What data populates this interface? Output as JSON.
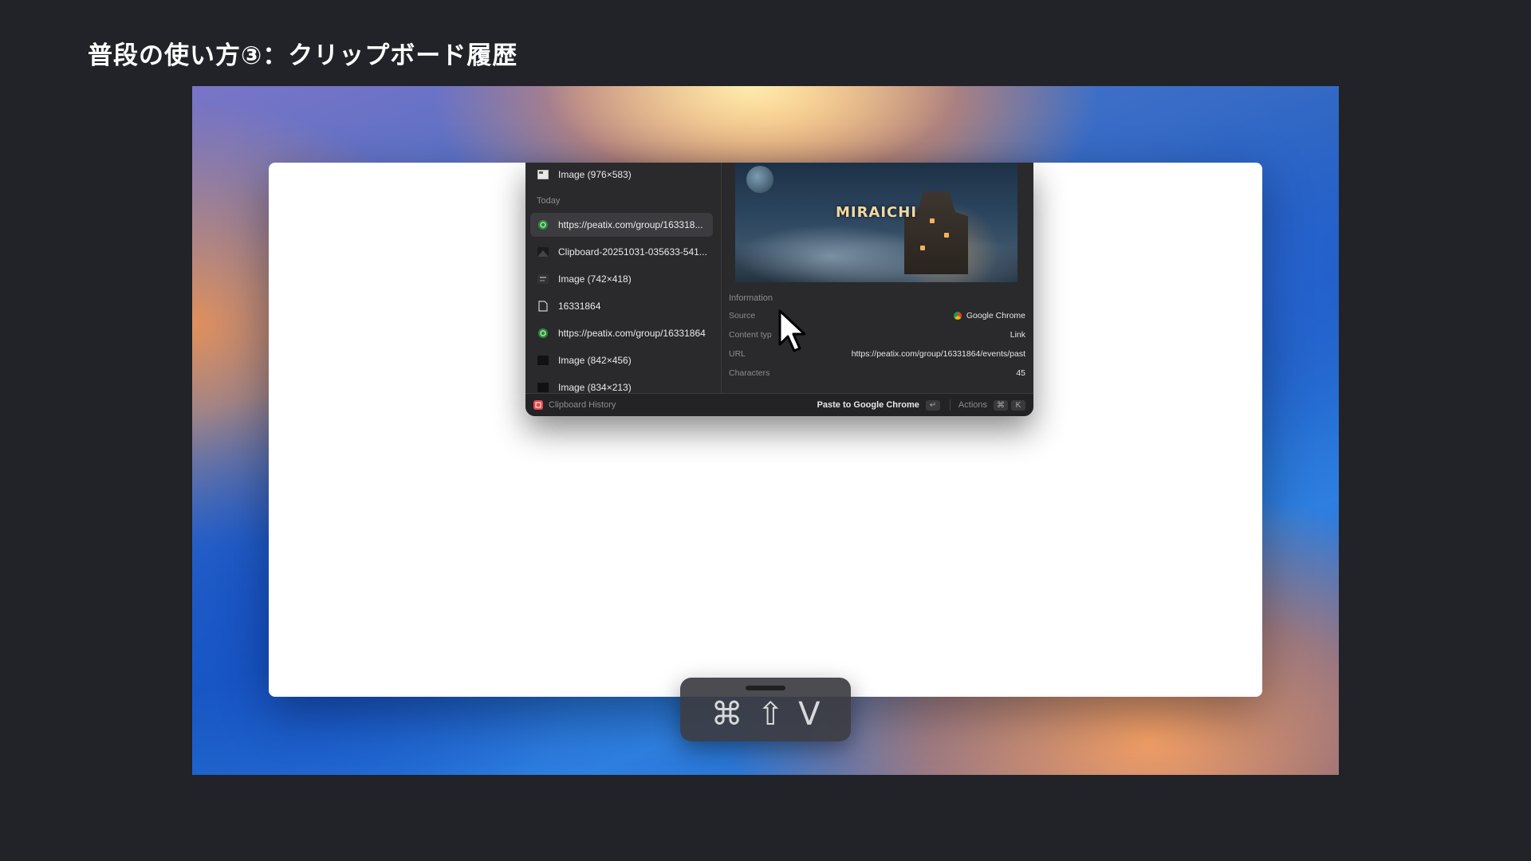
{
  "slide": {
    "title": "普段の使い方③：クリップボード履歴"
  },
  "clipboard": {
    "top_item": {
      "label": "Image (976×583)",
      "icon": "image-icon"
    },
    "section_label": "Today",
    "items": [
      {
        "label": "https://peatix.com/group/163318...",
        "icon": "link-icon",
        "selected": true
      },
      {
        "label": "Clipboard-20251031-035633-541...",
        "icon": "image-icon",
        "selected": false
      },
      {
        "label": "Image (742×418)",
        "icon": "image-icon",
        "selected": false
      },
      {
        "label": "16331864",
        "icon": "text-document-icon",
        "selected": false
      },
      {
        "label": "https://peatix.com/group/16331864",
        "icon": "link-icon",
        "selected": false
      },
      {
        "label": "Image (842×456)",
        "icon": "image-icon",
        "selected": false
      },
      {
        "label": "Image (834×213)",
        "icon": "image-icon",
        "selected": false
      }
    ],
    "preview": {
      "image_title": "MIRAICHI"
    },
    "information": {
      "heading": "Information",
      "rows": [
        {
          "key": "Source",
          "value": "Google Chrome"
        },
        {
          "key": "Content typ",
          "value": "Link"
        },
        {
          "key": "URL",
          "value": "https://peatix.com/group/16331864/events/past"
        },
        {
          "key": "Characters",
          "value": "45"
        }
      ]
    },
    "action_bar": {
      "extension_name": "Clipboard History",
      "primary_action": "Paste to Google Chrome",
      "primary_shortcut": "↵",
      "actions_label": "Actions",
      "actions_shortcut_1": "⌘",
      "actions_shortcut_2": "K"
    }
  },
  "hotkey_hud": {
    "key_1": "⌘",
    "key_2": "⇧",
    "key_3": "V"
  },
  "colors": {
    "background": "#212328",
    "panel": "#2a2a2c",
    "extension_icon": "#e5484d"
  }
}
